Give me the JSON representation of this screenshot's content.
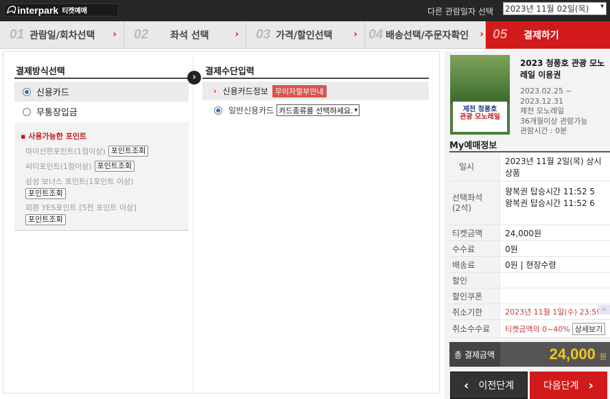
{
  "header": {
    "logo_mark": "ᗣ",
    "logo_brand": "interpark",
    "logo_sub": "티켓예매",
    "date_label": "다른 관람일자 선택",
    "date_value": "2023년 11월 02일(목)"
  },
  "steps": [
    {
      "num": "01",
      "label": "관람일/회차선택"
    },
    {
      "num": "02",
      "label": "좌석 선택"
    },
    {
      "num": "03",
      "label": "가격/할인선택"
    },
    {
      "num": "04",
      "label": "배송선택/주문자확인"
    },
    {
      "num": "05",
      "label": "결제하기"
    }
  ],
  "payment_method": {
    "title": "결제방식선택",
    "options": [
      "신용카드",
      "무통장입금"
    ],
    "selected": "신용카드"
  },
  "points": {
    "title": "사용가능한 포인트",
    "button_label": "포인트조회",
    "items": [
      "마이신한포인트(1점이상)",
      "씨티포인트(1점이상)",
      "삼성 보너스 포인트(1포인트 이상)",
      "외환 YES포인트 [5천 포인트 이상]"
    ]
  },
  "payment_input": {
    "title": "결제수단입력",
    "card_info_label": "신용카드정보",
    "badge": "무이자할부안내",
    "card_type_label": "일반신용카드",
    "card_select": "카드종류를 선택하세요."
  },
  "show": {
    "title": "2023 청풍호 관광 모노레일 이용권",
    "period": "2023.02.25 ~ 2023.12.31",
    "venue": "제천 모노레일",
    "age": "36개월이상 관람가능",
    "duration": "관람시간 : 0분",
    "poster_line1": "제천 청풍호",
    "poster_line2": "관광 모노레일"
  },
  "reservation": {
    "title": "My예매정보",
    "rows": [
      {
        "label": "일시",
        "value": [
          "2023년 11월 2일(목) 상시",
          "상품"
        ]
      },
      {
        "label": "선택좌석\n(2석)",
        "value": [
          "왕복권 탑승시간 11:52 5",
          "왕복권 탑승시간 11:52 6"
        ]
      },
      {
        "label": "티켓금액",
        "value": [
          "24,000원"
        ]
      },
      {
        "label": "수수료",
        "value": [
          "0원"
        ]
      },
      {
        "label": "배송료",
        "value": [
          "0원 | 현장수령"
        ]
      },
      {
        "label": "할인",
        "value": [
          ""
        ]
      },
      {
        "label": "할인쿠폰",
        "value": [
          ""
        ]
      },
      {
        "label": "취소기한",
        "value": [
          "2023년 11월 1일(수) 23:59"
        ]
      },
      {
        "label": "취소수수료",
        "value": [
          "티켓금액의 0~40%"
        ]
      }
    ],
    "detail_button": "상세보기",
    "total_label": "총 결제금액",
    "total_amount": "24,000",
    "total_unit": "원"
  },
  "nav": {
    "prev": "이전단계",
    "next": "다음단계"
  },
  "colors": {
    "accent": "#d31a1a",
    "total_amount": "#f5c518"
  }
}
